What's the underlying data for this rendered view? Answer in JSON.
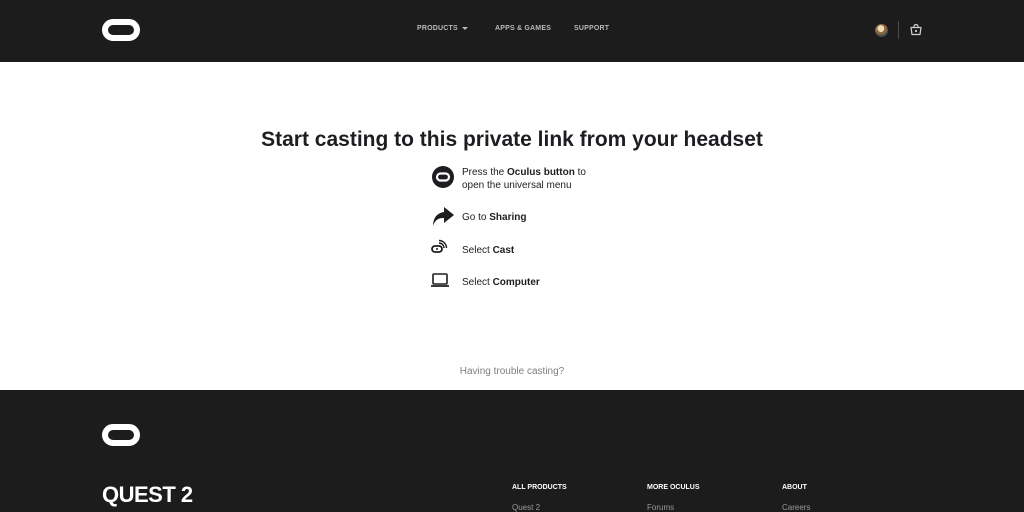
{
  "header": {
    "nav": [
      {
        "label": "PRODUCTS"
      },
      {
        "label": "APPS & GAMES"
      },
      {
        "label": "SUPPORT"
      }
    ]
  },
  "main": {
    "title": "Start casting to this private link from your headset",
    "steps": [
      {
        "icon": "oculus-button-icon",
        "prefix": "Press the ",
        "bold": "Oculus button",
        "suffix": " to",
        "line2": "open the universal menu"
      },
      {
        "icon": "share-arrow-icon",
        "prefix": "Go to ",
        "bold": "Sharing"
      },
      {
        "icon": "cast-icon",
        "prefix": "Select ",
        "bold": "Cast"
      },
      {
        "icon": "laptop-icon",
        "prefix": "Select ",
        "bold": "Computer"
      }
    ],
    "trouble_link": "Having trouble casting?"
  },
  "footer": {
    "brand": "QUEST 2",
    "columns": [
      {
        "title": "ALL PRODUCTS",
        "first_link": "Quest 2"
      },
      {
        "title": "MORE OCULUS",
        "first_link": "Forums"
      },
      {
        "title": "ABOUT",
        "first_link": "Careers"
      }
    ]
  },
  "colors": {
    "header_bg": "#1c1c1d",
    "footer_bg": "#1c1c1d",
    "text": "#1c1e21",
    "muted": "#7d7f82"
  }
}
